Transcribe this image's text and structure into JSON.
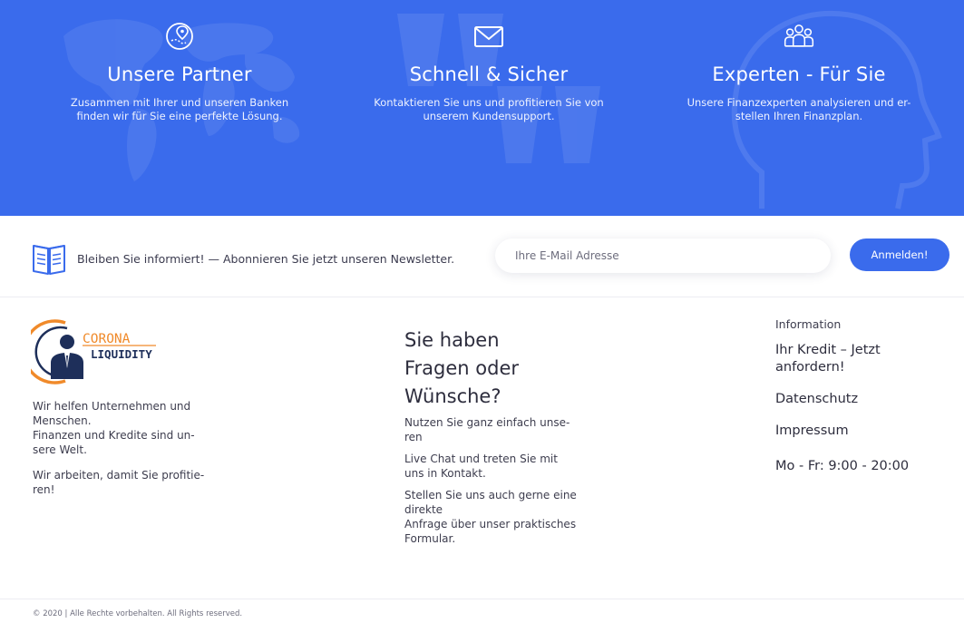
{
  "features": [
    {
      "icon": "map-pin-icon",
      "title": "Unsere Partner",
      "text": "Zusammen mit Ihrer und unseren Banken finden wir für Sie eine perfekte Lösung."
    },
    {
      "icon": "envelope-icon",
      "title": "Schnell & Sicher",
      "text": "Kontaktieren Sie uns und profitieren Sie von unserem Kundensupport."
    },
    {
      "icon": "team-icon",
      "title": "Experten - Für Sie",
      "text": "Unsere Finanzexperten analysieren und er-stellen Ihren Finanzplan."
    }
  ],
  "newsletter": {
    "icon": "open-book-icon",
    "text": "Bleiben Sie informiert! — Abonnieren Sie jetzt unseren Newsletter.",
    "email_placeholder": "Ihre E-Mail Adresse",
    "email_value": "",
    "button_label": "Anmelden!"
  },
  "footer": {
    "logo": {
      "word1": "CORONA",
      "word2": "LIQUIDITY"
    },
    "about_lines": [
      [
        "Wir helfen Unternehmen und",
        "Menschen.",
        "Finanzen und Kredite sind un-",
        "sere Welt."
      ],
      [
        "Wir arbeiten, damit Sie profitie-",
        "ren!"
      ]
    ],
    "contact": {
      "heading_lines": [
        "Sie haben",
        "Fragen oder",
        "Wünsche?"
      ],
      "paragraphs": [
        [
          "Nutzen Sie ganz einfach unse-",
          "ren"
        ],
        [
          "Live Chat und treten Sie mit",
          "uns in Kontakt."
        ],
        [
          "Stellen Sie uns auch gerne eine",
          "direkte",
          "Anfrage über unser praktisches",
          "Formular."
        ]
      ]
    },
    "info": {
      "title": "Information",
      "links": [
        "Ihr Kredit – Jetzt anfordern!",
        "Datenschutz",
        "Impressum"
      ],
      "hours": "Mo - Fr: 9:00 - 20:00"
    },
    "copyright": "© 2020 | Alle Rechte vorbehalten. All Rights reserved."
  },
  "colors": {
    "brand_blue": "#3a6bec",
    "logo_orange": "#f08a2a",
    "logo_navy": "#1e2f5a"
  }
}
